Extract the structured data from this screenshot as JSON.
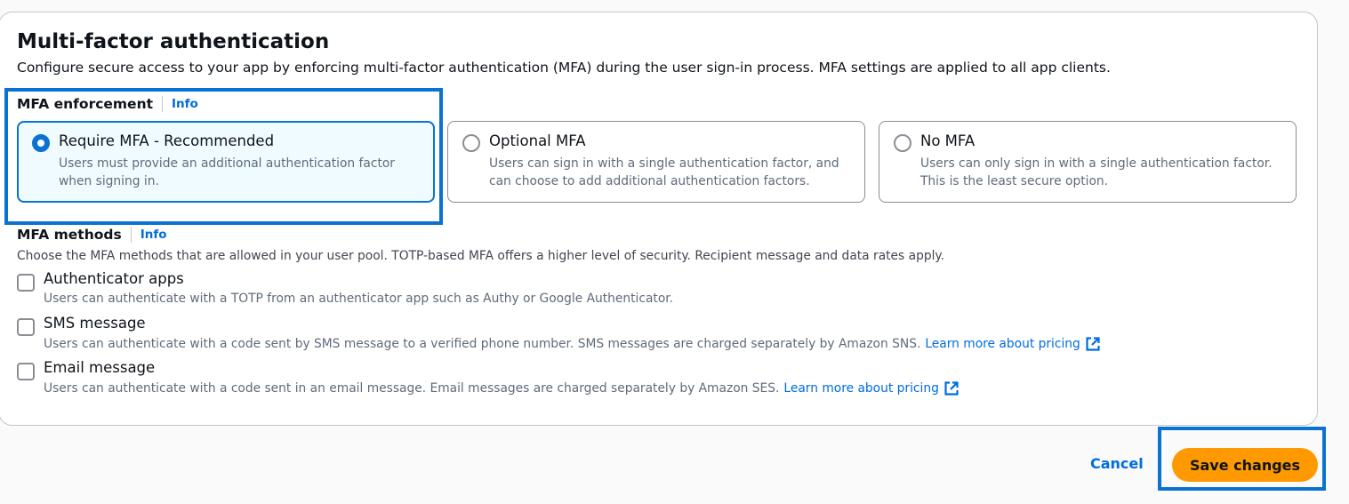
{
  "section": {
    "title": "Multi-factor authentication",
    "description": "Configure secure access to your app by enforcing multi-factor authentication (MFA) during the user sign-in process. MFA settings are applied to all app clients."
  },
  "enforcement": {
    "label": "MFA enforcement",
    "info": "Info",
    "options": [
      {
        "title": "Require MFA - Recommended",
        "description": "Users must provide an additional authentication factor when signing in.",
        "selected": true
      },
      {
        "title": "Optional MFA",
        "description": "Users can sign in with a single authentication factor, and can choose to add additional authentication factors.",
        "selected": false
      },
      {
        "title": "No MFA",
        "description": "Users can only sign in with a single authentication factor. This is the least secure option.",
        "selected": false
      }
    ]
  },
  "methods": {
    "label": "MFA methods",
    "info": "Info",
    "description": "Choose the MFA methods that are allowed in your user pool. TOTP-based MFA offers a higher level of security. Recipient message and data rates apply.",
    "items": [
      {
        "title": "Authenticator apps",
        "description": "Users can authenticate with a TOTP from an authenticator app such as Authy or Google Authenticator.",
        "checked": false
      },
      {
        "title": "SMS message",
        "description": "Users can authenticate with a code sent by SMS message to a verified phone number. SMS messages are charged separately by Amazon SNS.",
        "link": "Learn more about pricing",
        "checked": false
      },
      {
        "title": "Email message",
        "description": "Users can authenticate with a code sent in an email message. Email messages are charged separately by Amazon SES.",
        "link": "Learn more about pricing",
        "checked": false
      }
    ]
  },
  "actions": {
    "cancel": "Cancel",
    "save": "Save changes"
  },
  "colors": {
    "primary_blue": "#0972d3",
    "link_blue": "#006ce0",
    "save_orange": "#ff9900"
  }
}
